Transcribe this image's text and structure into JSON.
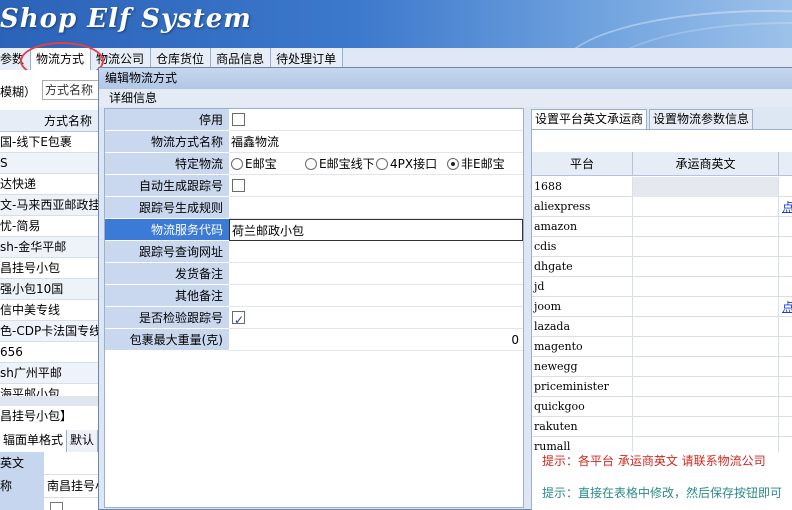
{
  "app": {
    "title": "Shop Elf System"
  },
  "menu": [
    {
      "label": "参数",
      "active": false
    },
    {
      "label": "物流方式",
      "active": true
    },
    {
      "label": "物流公司",
      "active": false
    },
    {
      "label": "仓库货位",
      "active": false
    },
    {
      "label": "商品信息",
      "active": false
    },
    {
      "label": "待处理订单",
      "active": false
    }
  ],
  "left_panel": {
    "search_label": "模糊）",
    "search_placeholder": "方式名称",
    "column_header": "方式名称",
    "rows": [
      "国-线下E包裹",
      "S",
      "达快递",
      "文-马来西亚邮政挂",
      "忧-简易",
      "sh-金华平邮",
      "昌挂号小包",
      "强小包10国",
      "信中美专线",
      "色-CDP卡法国专线",
      "656",
      "sh广州平邮",
      "海平邮小包"
    ],
    "group_label": "昌挂号小包】",
    "tabs": [
      "辐面单格式",
      "默认"
    ],
    "detail_rows": [
      {
        "key": "英文",
        "value": ""
      },
      {
        "key": "称",
        "value": "南昌挂号小"
      },
      {
        "key": "",
        "value": ""
      }
    ]
  },
  "dialog": {
    "title": "编辑物流方式",
    "section": "详细信息",
    "fields": [
      {
        "label": "停用",
        "type": "checkbox",
        "checked": false
      },
      {
        "label": "物流方式名称",
        "type": "text",
        "value": "福鑫物流"
      },
      {
        "label": "特定物流",
        "type": "radio",
        "options": [
          "E邮宝",
          "E邮宝线下",
          "4PX接口",
          "非E邮宝"
        ],
        "selected": "非E邮宝"
      },
      {
        "label": "自动生成跟踪号",
        "type": "checkbox",
        "checked": false
      },
      {
        "label": "跟踪号生成规则",
        "type": "text",
        "value": ""
      },
      {
        "label": "物流服务代码",
        "type": "text",
        "value": "荷兰邮政小包",
        "selected": true
      },
      {
        "label": "跟踪号查询网址",
        "type": "text",
        "value": ""
      },
      {
        "label": "发货备注",
        "type": "text",
        "value": ""
      },
      {
        "label": "其他备注",
        "type": "text",
        "value": ""
      },
      {
        "label": "是否检验跟踪号",
        "type": "checkbox",
        "checked": true
      },
      {
        "label": "包裹最大重量(克)",
        "type": "number",
        "value": "0"
      }
    ],
    "right_tabs": [
      "设置平台英文承运商",
      "设置物流参数信息"
    ],
    "carrier_grid": {
      "headers": [
        "平台",
        "承运商英文"
      ],
      "rows": [
        {
          "platform": "1688",
          "link": ""
        },
        {
          "platform": "aliexpress",
          "link": "点"
        },
        {
          "platform": "amazon",
          "link": ""
        },
        {
          "platform": "cdis",
          "link": ""
        },
        {
          "platform": "dhgate",
          "link": ""
        },
        {
          "platform": "jd",
          "link": ""
        },
        {
          "platform": "joom",
          "link": "点"
        },
        {
          "platform": "lazada",
          "link": ""
        },
        {
          "platform": "magento",
          "link": ""
        },
        {
          "platform": "newegg",
          "link": ""
        },
        {
          "platform": "priceminister",
          "link": ""
        },
        {
          "platform": "quickgoo",
          "link": ""
        },
        {
          "platform": "rakuten",
          "link": ""
        },
        {
          "platform": "rumall",
          "link": ""
        }
      ]
    },
    "tip1": "提示：各平台 承运商英文 请联系物流公司",
    "tip2": "提示：直接在表格中修改，然后保存按钮即可"
  }
}
